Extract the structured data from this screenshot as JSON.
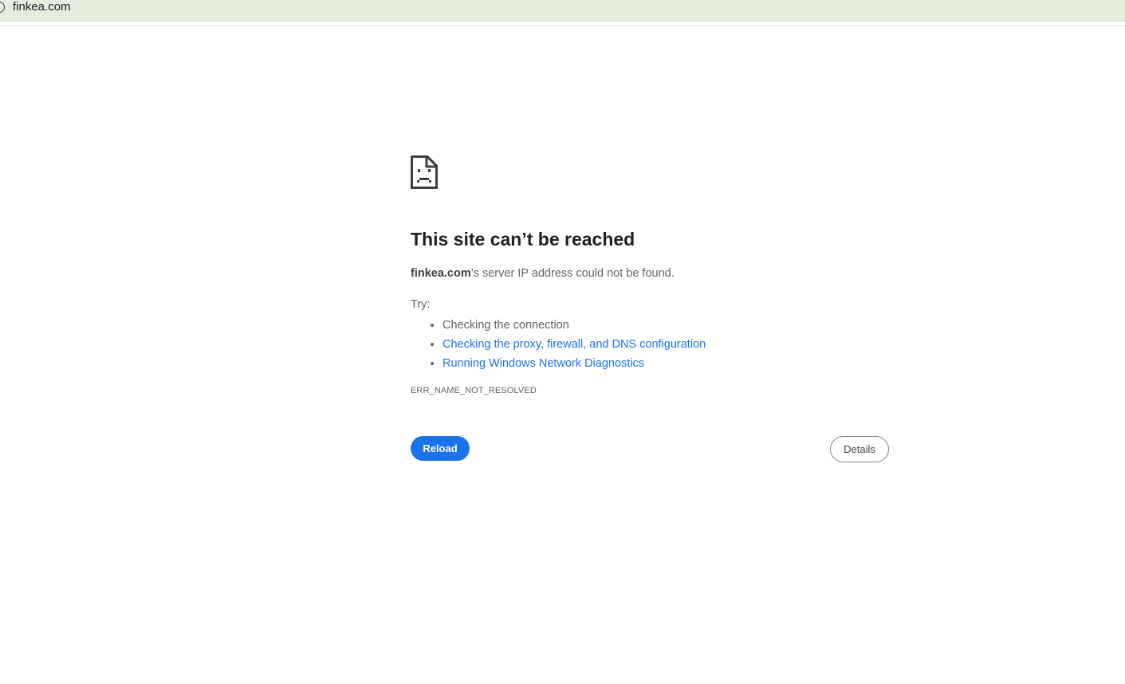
{
  "address_bar": {
    "url": "finkea.com"
  },
  "icons": {
    "site_info": "site-info-icon",
    "error": "sad-document-icon"
  },
  "error": {
    "title": "This site can’t be reached",
    "host": "finkea.com",
    "summary_suffix": "’s server IP address could not be found.",
    "try_label": "Try:",
    "suggestions": [
      {
        "label": "Checking the connection",
        "is_link": false
      },
      {
        "label": "Checking the proxy, firewall, and DNS configuration",
        "is_link": true
      },
      {
        "label": "Running Windows Network Diagnostics",
        "is_link": true
      }
    ],
    "code": "ERR_NAME_NOT_RESOLVED"
  },
  "buttons": {
    "reload_label": "Reload",
    "details_label": "Details"
  },
  "colors": {
    "toolbar_bg": "#e5eedd",
    "primary": "#1a73e8",
    "link": "#1a73e8",
    "text_secondary": "#5f6368"
  }
}
